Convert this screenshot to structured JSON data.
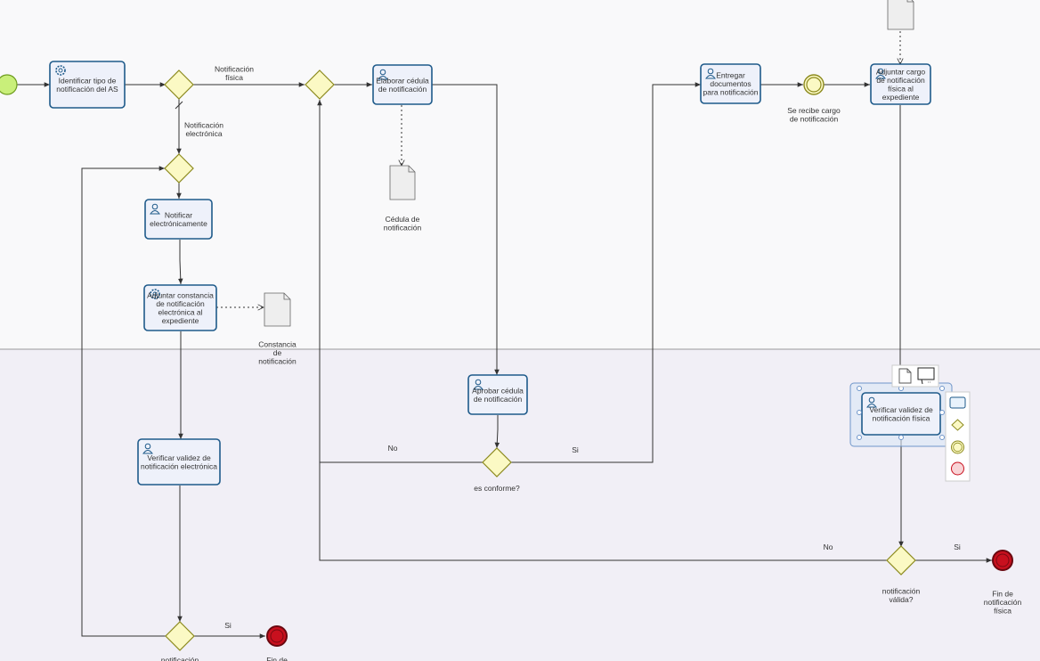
{
  "tasks": [
    {
      "id": "t1",
      "lines": [
        "Identificar tipo de",
        "notificación del AS"
      ],
      "kind": "service"
    },
    {
      "id": "t2",
      "lines": [
        "Elaborar cédula",
        "de notificación"
      ],
      "kind": "user"
    },
    {
      "id": "t3",
      "lines": [
        "Entregar",
        "documentos",
        "para notificación"
      ],
      "kind": "user"
    },
    {
      "id": "t4",
      "lines": [
        "Adjuntar cargo",
        "de notificación",
        "física al",
        "expediente"
      ],
      "kind": "user"
    },
    {
      "id": "t5",
      "lines": [
        "Notificar",
        "electrónicamente"
      ],
      "kind": "user"
    },
    {
      "id": "t6",
      "lines": [
        "Adjuntar constancia",
        "de notificación",
        "electrónica al",
        "expediente"
      ],
      "kind": "service"
    },
    {
      "id": "t7",
      "lines": [
        "Aprobar cédula",
        "de notificación"
      ],
      "kind": "user"
    },
    {
      "id": "t8",
      "lines": [
        "Verificar validez de",
        "notificación electrónica"
      ],
      "kind": "user"
    },
    {
      "id": "t9",
      "lines": [
        "Verificar validez de",
        "notificación física"
      ],
      "kind": "user"
    }
  ],
  "gateways": [
    {
      "id": "g1",
      "label": []
    },
    {
      "id": "g2",
      "label": []
    },
    {
      "id": "g3",
      "label": []
    },
    {
      "id": "g4",
      "label": [
        "es conforme?"
      ]
    },
    {
      "id": "g5",
      "label": [
        "notificación",
        "válida?"
      ]
    },
    {
      "id": "g6",
      "label": [
        "notificación"
      ]
    }
  ],
  "events": [
    {
      "id": "e_start",
      "type": "start",
      "label": []
    },
    {
      "id": "e_int",
      "type": "intermediate",
      "label": [
        "Se recibe cargo",
        "de notificación"
      ]
    },
    {
      "id": "e_end1",
      "type": "end",
      "label": [
        "Fin de",
        "notificación",
        "física"
      ]
    },
    {
      "id": "e_end2",
      "type": "end",
      "label": [
        "Fin de"
      ]
    }
  ],
  "data_objects": [
    {
      "id": "d1",
      "label": [
        "Cédula de",
        "notificación"
      ]
    },
    {
      "id": "d2",
      "label": [
        "Constancia",
        "de",
        "notificación"
      ]
    },
    {
      "id": "d3",
      "label": []
    }
  ],
  "flow_labels": [
    {
      "id": "fl1",
      "lines": [
        "Notificación",
        "física"
      ]
    },
    {
      "id": "fl2",
      "lines": [
        "Notificación",
        "electrónica"
      ]
    },
    {
      "id": "fl3",
      "lines": [
        "No"
      ]
    },
    {
      "id": "fl4",
      "lines": [
        "Si"
      ]
    },
    {
      "id": "fl5",
      "lines": [
        "No"
      ]
    },
    {
      "id": "fl6",
      "lines": [
        "Si"
      ]
    },
    {
      "id": "fl7",
      "lines": [
        "Si"
      ]
    }
  ],
  "palette": {
    "items": [
      "task-shape",
      "gateway-shape",
      "intermediate-event-shape",
      "end-event-shape"
    ]
  },
  "colors": {
    "task_stroke": "#1e5a8a",
    "task_fill": "#eef1fa",
    "gateway_fill": "#fbf9c4",
    "start_fill": "#c9ef7a",
    "end_fill": "#c8101e",
    "lane_bottom": "#f1eff6"
  }
}
